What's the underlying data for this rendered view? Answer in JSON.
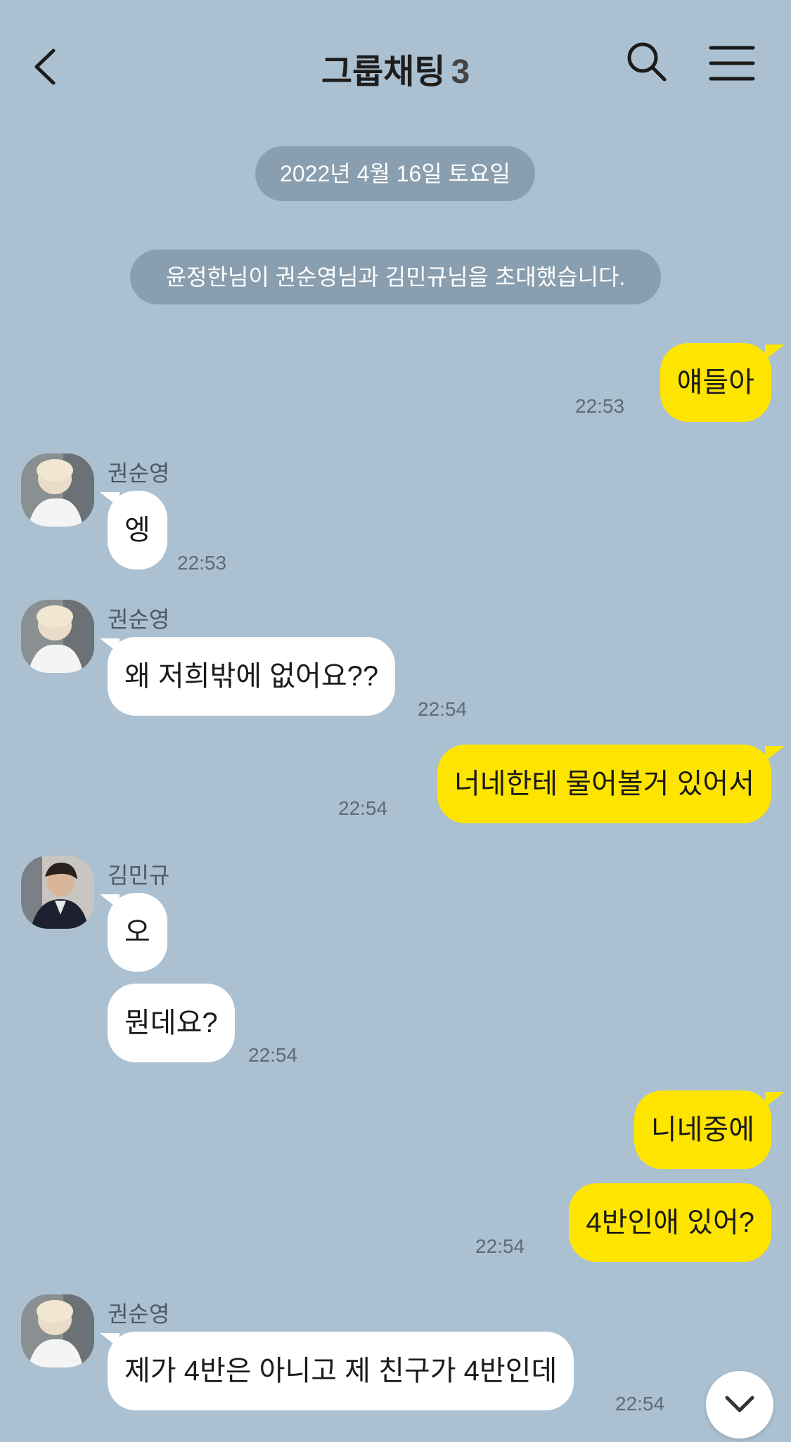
{
  "header": {
    "title": "그룹채팅",
    "member_count": "3",
    "back_icon": "chevron-left-icon",
    "search_icon": "search-icon",
    "menu_icon": "hamburger-menu-icon"
  },
  "date_divider": "2022년 4월 16일 토요일",
  "system_notice": "윤정한님이 권순영님과 김민규님을 초대했습니다.",
  "messages": [
    {
      "sender": "me",
      "text": "얘들아",
      "time": "22:53"
    },
    {
      "sender": "권순영",
      "text": "엥",
      "time": "22:53"
    },
    {
      "sender": "권순영",
      "text": "왜 저희밖에 없어요??",
      "time": "22:54"
    },
    {
      "sender": "me",
      "text": "너네한테 물어볼거 있어서",
      "time": "22:54"
    },
    {
      "sender": "김민규",
      "text": "오",
      "time": ""
    },
    {
      "sender": "김민규",
      "text": "뭔데요?",
      "time": "22:54"
    },
    {
      "sender": "me",
      "text": "니네중에",
      "time": ""
    },
    {
      "sender": "me",
      "text": "4반인애 있어?",
      "time": "22:54"
    },
    {
      "sender": "권순영",
      "text": "제가 4반은 아니고 제 친구가 4반인데",
      "time": "22:54"
    }
  ],
  "colors": {
    "background": "#abc1d1",
    "my_bubble": "#fee500",
    "other_bubble": "#ffffff"
  },
  "scroll_down_icon": "chevron-down-icon"
}
